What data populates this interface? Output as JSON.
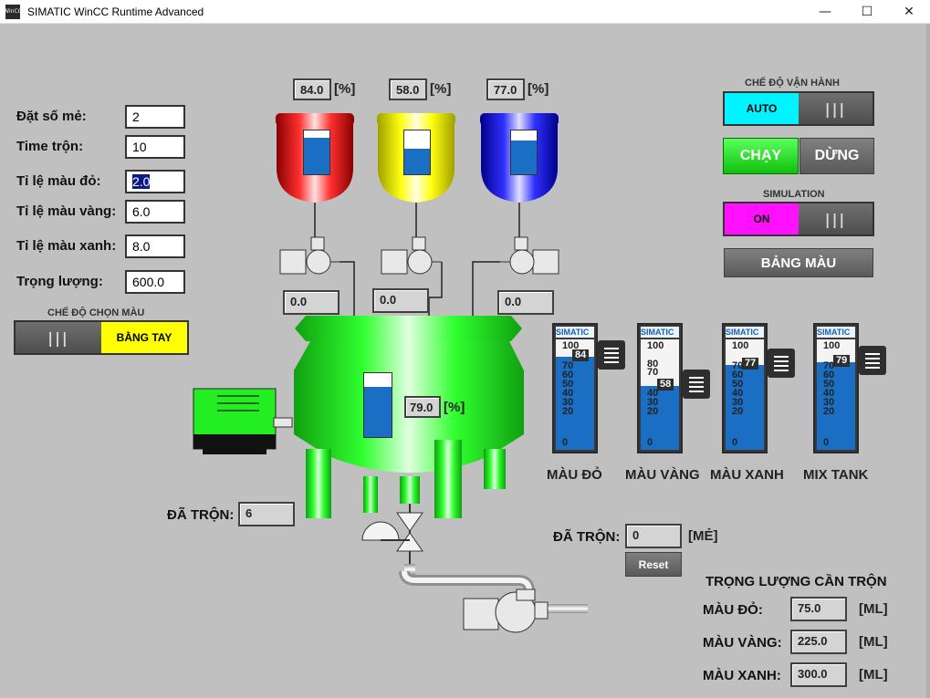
{
  "window": {
    "title": "SIMATIC WinCC Runtime Advanced",
    "icon_text": "WinCC",
    "minimize": "—",
    "maximize": "☐",
    "close": "✕"
  },
  "params": {
    "batch_label": "Đặt số mẻ:",
    "batch_value": "2",
    "mix_time_label": "Time trộn:",
    "mix_time_value": "10",
    "red_ratio_label": "Tỉ lệ màu đỏ:",
    "red_ratio_value": "2.0",
    "yellow_ratio_label": "Tỉ lệ màu vàng:",
    "yellow_ratio_value": "6.0",
    "blue_ratio_label": "Tỉ lệ màu xanh:",
    "blue_ratio_value": "8.0",
    "weight_label": "Trọng lượng:",
    "weight_value": "600.0"
  },
  "color_mode": {
    "title": "CHẾ ĐỘ CHỌN MÀU",
    "left": "|||",
    "right": "BẰNG TAY"
  },
  "tanks": {
    "red": {
      "level_value": "84.0",
      "unit": "[%]",
      "flow_value": "0.0",
      "fill": 0.84,
      "color": "#ff2a2a"
    },
    "yellow": {
      "level_value": "58.0",
      "unit": "[%]",
      "flow_value": "0.0",
      "fill": 0.58,
      "color": "#ffff00"
    },
    "blue": {
      "level_value": "77.0",
      "unit": "[%]",
      "flow_value": "0.0",
      "fill": 0.77,
      "color": "#2a2aff"
    },
    "mix": {
      "level_value": "79.0",
      "unit": "[%]",
      "fill": 0.79,
      "color": "#22ff22"
    }
  },
  "operation": {
    "mode_title": "CHẾ ĐỘ VẬN HÀNH",
    "mode_auto": "AUTO",
    "mode_bars": "|||",
    "run": "CHẠY",
    "stop": "DỪNG",
    "sim_title": "SIMULATION",
    "sim_on": "ON",
    "sim_bars": "|||",
    "color_table": "BẢNG MÀU"
  },
  "sliders": [
    {
      "name": "MÀU ĐỎ",
      "head": "SIMATIC",
      "top": "100",
      "ticks": [
        "70",
        "60",
        "50",
        "40",
        "30",
        "20"
      ],
      "extra": "",
      "zero": "0",
      "value": "84",
      "fill": 0.84
    },
    {
      "name": "MÀU VÀNG",
      "head": "SIMATIC",
      "top": "100",
      "ticks": [
        "40",
        "30",
        "20"
      ],
      "extra": "80",
      "extra2": "70",
      "zero": "0",
      "value": "58",
      "fill": 0.58
    },
    {
      "name": "MÀU XANH",
      "head": "SIMATIC",
      "top": "100",
      "ticks": [
        "70",
        "60",
        "50",
        "40",
        "30",
        "20"
      ],
      "extra": "",
      "zero": "0",
      "value": "77",
      "fill": 0.77
    },
    {
      "name": "MIX TANK",
      "head": "SIMATIC",
      "top": "100",
      "ticks": [
        "70",
        "60",
        "50",
        "40",
        "30",
        "20"
      ],
      "extra": "",
      "zero": "0",
      "value": "79",
      "fill": 0.79
    }
  ],
  "mixed_left": {
    "label": "ĐÃ TRỘN:",
    "value": "6"
  },
  "mixed_right": {
    "label": "ĐÃ TRỘN:",
    "value": "0",
    "unit": "[MẺ]",
    "reset": "Reset"
  },
  "required_weight": {
    "title": "TRỌNG LƯỢNG CẦN TRỘN",
    "red_label": "MÀU ĐỎ:",
    "red_value": "75.0",
    "yellow_label": "MÀU VÀNG:",
    "yellow_value": "225.0",
    "blue_label": "MÀU XANH:",
    "blue_value": "300.0",
    "unit": "[ML]"
  }
}
